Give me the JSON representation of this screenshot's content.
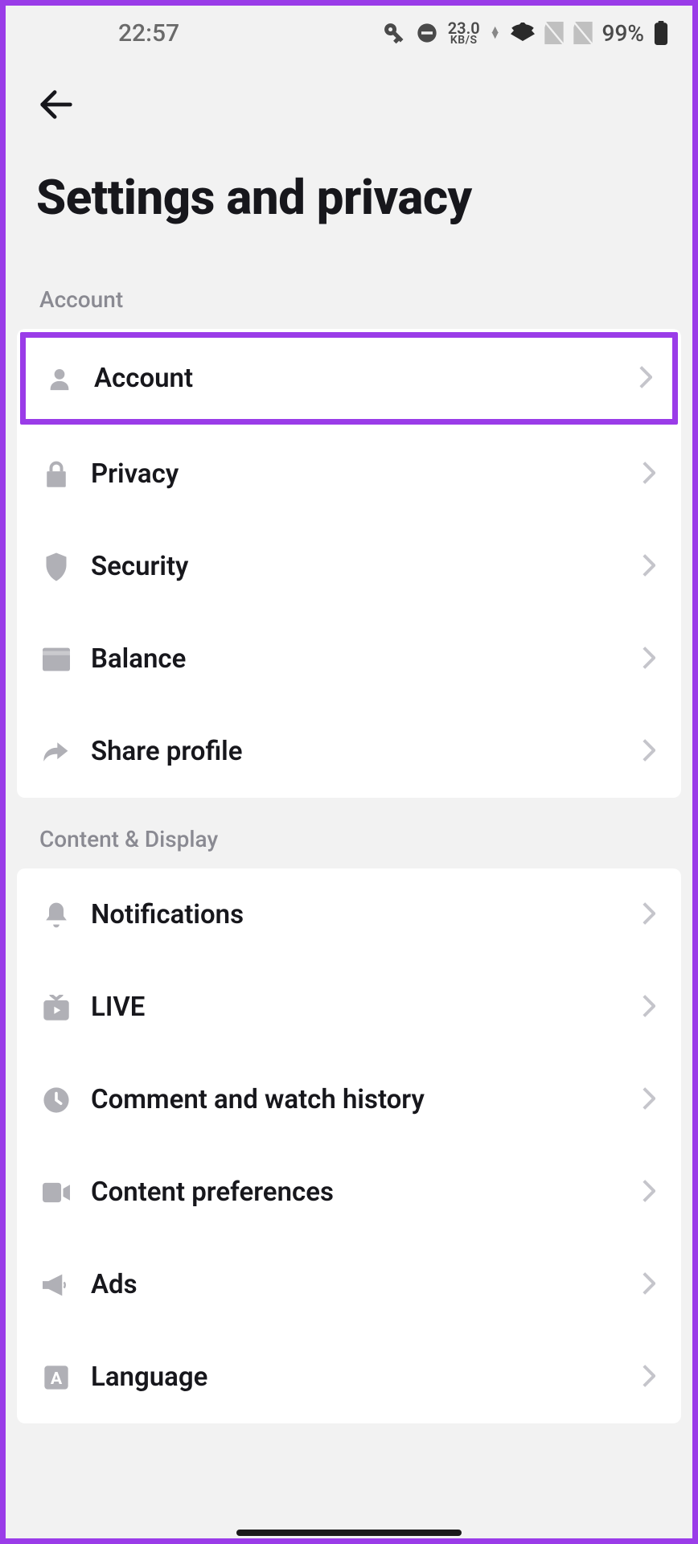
{
  "status_bar": {
    "time": "22:57",
    "data_rate_value": "23.0",
    "data_rate_unit": "KB/S",
    "battery_pct": "99%"
  },
  "header": {
    "title": "Settings and privacy"
  },
  "sections": {
    "account": {
      "title": "Account",
      "items": {
        "account": "Account",
        "privacy": "Privacy",
        "security": "Security",
        "balance": "Balance",
        "share_profile": "Share profile"
      }
    },
    "content_display": {
      "title": "Content & Display",
      "items": {
        "notifications": "Notifications",
        "live": "LIVE",
        "comment_history": "Comment and watch history",
        "content_prefs": "Content preferences",
        "ads": "Ads",
        "language": "Language"
      }
    }
  }
}
